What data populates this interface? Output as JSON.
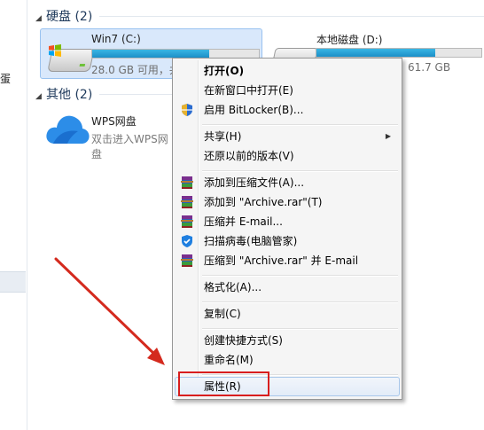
{
  "groups": {
    "hard_disks": "硬盘 (2)",
    "others": "其他 (2)"
  },
  "left_pane": {
    "glyph": "蛋"
  },
  "drives": [
    {
      "name": "Win7 (C:)",
      "size_text": "28.0 GB 可用，共",
      "used_fraction": 0.7
    },
    {
      "name": "本地磁盘 (D:)",
      "size_text": "61.7 GB",
      "used_fraction": 0.72
    }
  ],
  "wps": {
    "name": "WPS网盘",
    "subtitle": "双击进入WPS网盘"
  },
  "context_menu": {
    "items": [
      {
        "label": "打开(O)",
        "bold": true
      },
      {
        "label": "在新窗口中打开(E)"
      },
      {
        "label": "启用 BitLocker(B)...",
        "icon": "shield-icon"
      },
      {
        "label": "共享(H)",
        "submenu": true
      },
      {
        "label": "还原以前的版本(V)"
      },
      {
        "label": "添加到压缩文件(A)...",
        "icon": "winrar-icon"
      },
      {
        "label": "添加到 \"Archive.rar\"(T)",
        "icon": "winrar-icon"
      },
      {
        "label": "压缩并 E-mail...",
        "icon": "winrar-icon"
      },
      {
        "label": "扫描病毒(电脑管家)",
        "icon": "antivirus-shield-icon"
      },
      {
        "label": "压缩到 \"Archive.rar\" 并 E-mail",
        "icon": "winrar-icon"
      },
      {
        "label": "格式化(A)..."
      },
      {
        "label": "复制(C)"
      },
      {
        "label": "创建快捷方式(S)"
      },
      {
        "label": "重命名(M)"
      },
      {
        "label": "属性(R)",
        "highlighted": true
      }
    ]
  },
  "colors": {
    "highlight_box": "#d81e1e",
    "annotation_arrow": "#d42a1e",
    "drive_bar_fill": "#1c8fc7"
  }
}
